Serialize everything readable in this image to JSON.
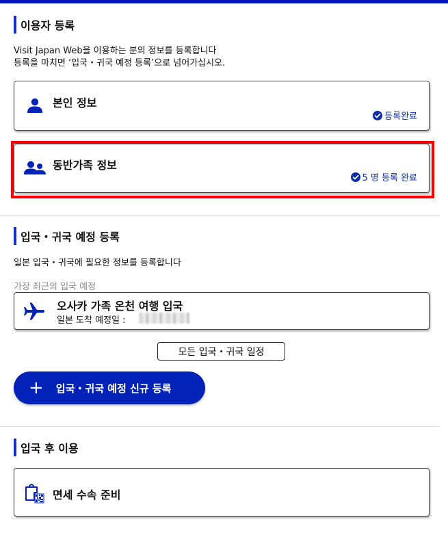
{
  "colors": {
    "accent": "#0323b8",
    "highlight": "#ff0000",
    "status": "#0b2ea3"
  },
  "user_registration": {
    "title": "이용자 등록",
    "desc_line1": "Visit Japan Web을 이용하는 분의 정보를 등록합니다",
    "desc_line2": "등록을 마치면 ‘입국・귀국 예정 등록’으로 넘어가십시오.",
    "personal_info": {
      "title": "본인 정보",
      "status": "등록완료",
      "icon": "person-icon"
    },
    "companion_info": {
      "title": "동반가족 정보",
      "status": "5 명 등록 완료",
      "icon": "group-icon"
    }
  },
  "entry_registration": {
    "title": "입국・귀국 예정 등록",
    "desc": "일본 입국・귀국에 필요한 정보를 등록합니다",
    "recent_label": "가장 최근의 입국 예정",
    "trip": {
      "title": "오사카 가족 온천 여행 입국",
      "date_label": "일본 도착 예정일 :",
      "icon": "airplane-icon"
    },
    "all_schedules_button": "모든 입국・귀국 일정",
    "new_registration_button": "입국・귀국 예정 신규 등록"
  },
  "after_entry": {
    "title": "입국 후 이용",
    "tax_free": {
      "title": "면세 수속 준비",
      "icon": "shopping-bag-qr-icon"
    }
  }
}
